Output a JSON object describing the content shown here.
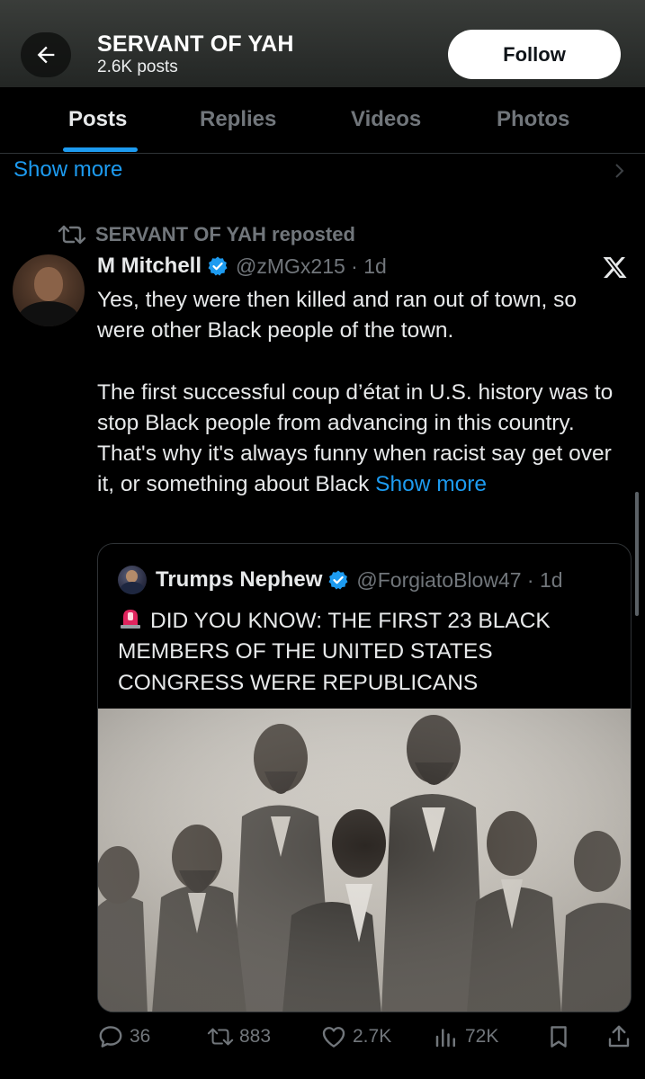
{
  "header": {
    "profile_name": "SERVANT OF YAH",
    "post_count": "2.6K posts",
    "follow_label": "Follow"
  },
  "tabs": [
    {
      "label": "Posts",
      "active": true
    },
    {
      "label": "Replies",
      "active": false
    },
    {
      "label": "Videos",
      "active": false
    },
    {
      "label": "Photos",
      "active": false
    }
  ],
  "previous_post": {
    "show_more": "Show more"
  },
  "tweet": {
    "repost_label": "SERVANT OF YAH reposted",
    "author_name": "M Mitchell",
    "handle_time": "@zMGx215 · 1d",
    "paragraph_1": "Yes, they were then killed and ran out of town, so were other Black people of the town.",
    "paragraph_2": "The first successful coup d’état in U.S. history was to stop Black people from advancing in this country. That's why it's always funny when racist say get over it, or something about Black",
    "show_more": "Show more",
    "quote": {
      "author_name": "Trumps Nephew",
      "handle_time": "@ForgiatoBlow47 · 1d",
      "text": "DID YOU KNOW: THE FIRST 23 BLACK MEMBERS OF THE UNITED STATES CONGRESS WERE REPUBLICANS"
    },
    "actions": {
      "replies": "36",
      "reposts": "883",
      "likes": "2.7K",
      "views": "72K"
    }
  },
  "colors": {
    "accent": "#1d9bf0",
    "text": "#e7e9ea",
    "muted": "#71767b",
    "background": "#000000",
    "siren": "#e0245e"
  },
  "icons": [
    "back-arrow-icon",
    "chevron-right-icon",
    "repost-icon",
    "verified-badge-icon",
    "x-logo-icon",
    "siren-icon",
    "reply-icon",
    "like-icon",
    "views-icon",
    "bookmark-icon",
    "share-icon"
  ]
}
